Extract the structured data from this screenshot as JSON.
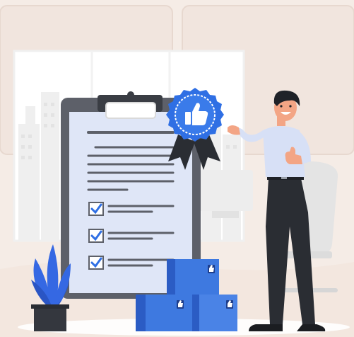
{
  "illustration": {
    "subject": "approved-checklist-scene",
    "checklist": {
      "items": [
        {
          "checked": true
        },
        {
          "checked": true
        },
        {
          "checked": true
        }
      ]
    },
    "badge": {
      "icon": "thumbs-up-icon"
    },
    "colors": {
      "background": "#f5ece6",
      "wall_panel": "#efe3dc",
      "window": "#ffffff",
      "building": "#eeeeee",
      "clipboard_board": "#5d5f66",
      "paper": "#dfe6f8",
      "accent_blue": "#2f6fe4",
      "dark_blue": "#1e3e8c",
      "box_blue": "#3e79e0",
      "box_side": "#2b5cc4",
      "person_shirt": "#d7e0f6",
      "person_pants": "#2a2d33",
      "skin": "#f3a585",
      "hair": "#1f2228",
      "plant_pot": "#3a3d44",
      "chair": "#e6e6e6"
    }
  }
}
